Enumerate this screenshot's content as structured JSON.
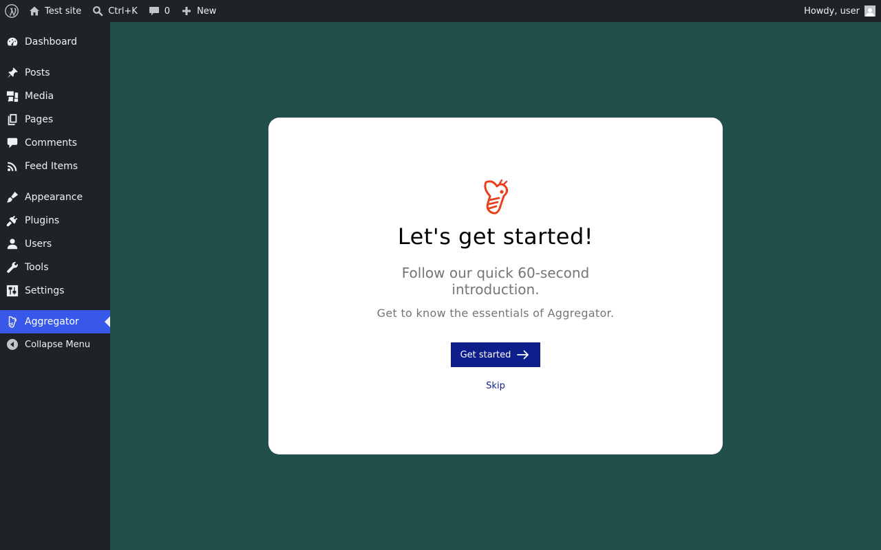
{
  "adminbar": {
    "wp_logo": "wordpress-icon",
    "site_name": "Test site",
    "search_shortcut": "Ctrl+K",
    "comments_count": "0",
    "new_label": "New",
    "howdy": "Howdy, user"
  },
  "sidebar": {
    "items": [
      {
        "label": "Dashboard",
        "icon": "dashboard-icon"
      },
      {
        "label": "Posts",
        "icon": "pin-icon"
      },
      {
        "label": "Media",
        "icon": "media-icon"
      },
      {
        "label": "Pages",
        "icon": "pages-icon"
      },
      {
        "label": "Comments",
        "icon": "comment-icon"
      },
      {
        "label": "Feed Items",
        "icon": "rss-icon"
      },
      {
        "label": "Appearance",
        "icon": "brush-icon"
      },
      {
        "label": "Plugins",
        "icon": "plugin-icon"
      },
      {
        "label": "Users",
        "icon": "user-icon"
      },
      {
        "label": "Tools",
        "icon": "wrench-icon"
      },
      {
        "label": "Settings",
        "icon": "settings-icon"
      },
      {
        "label": "Aggregator",
        "icon": "bee-icon",
        "current": true
      }
    ],
    "collapse_label": "Collapse Menu"
  },
  "card": {
    "title": "Let's get started!",
    "subtitle": "Follow our quick 60-second introduction.",
    "text": "Get to know the essentials of Aggregator.",
    "primary_button": "Get started",
    "skip_link": "Skip"
  },
  "colors": {
    "background": "#224f4c",
    "admin_dark": "#1d2327",
    "accent": "#3858e9",
    "button": "#0e1f8b",
    "logo": "#e8401c"
  }
}
